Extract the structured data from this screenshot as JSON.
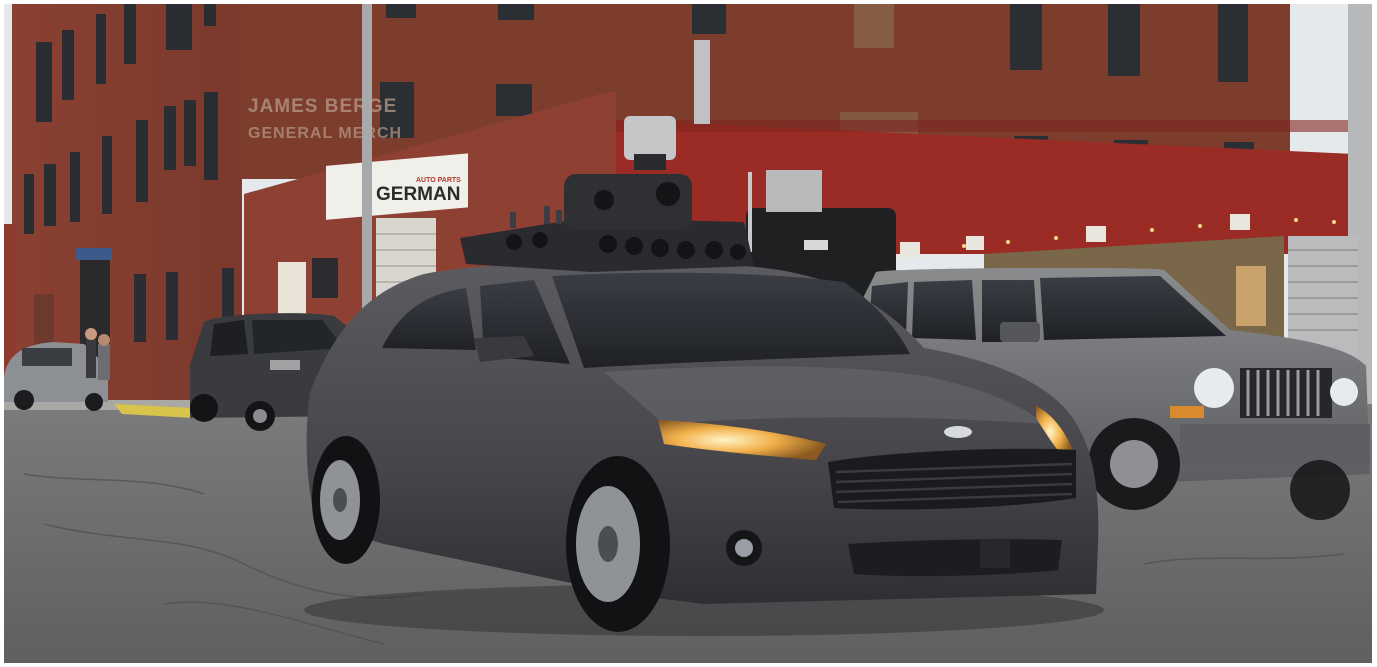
{
  "scene": {
    "alt": "Self-driving test sedan with a roof-mounted sensor array on a city street, parked cars and brick buildings behind it",
    "colors": {
      "sky": "#e6e9ec",
      "brick_dark": "#7c3c2e",
      "brick_mid": "#8e4536",
      "red_wall": "#9a2a24",
      "road": "#6f6f70",
      "car_body": "#4b4b4f",
      "suv_body": "#77787a"
    }
  },
  "signage": {
    "ghost_sign_line1": "JAMES  BERGE",
    "ghost_sign_line2": "GENERAL  MERCH",
    "store_sign_main": "GERMAN",
    "store_sign_sub": "AUTO PARTS"
  }
}
